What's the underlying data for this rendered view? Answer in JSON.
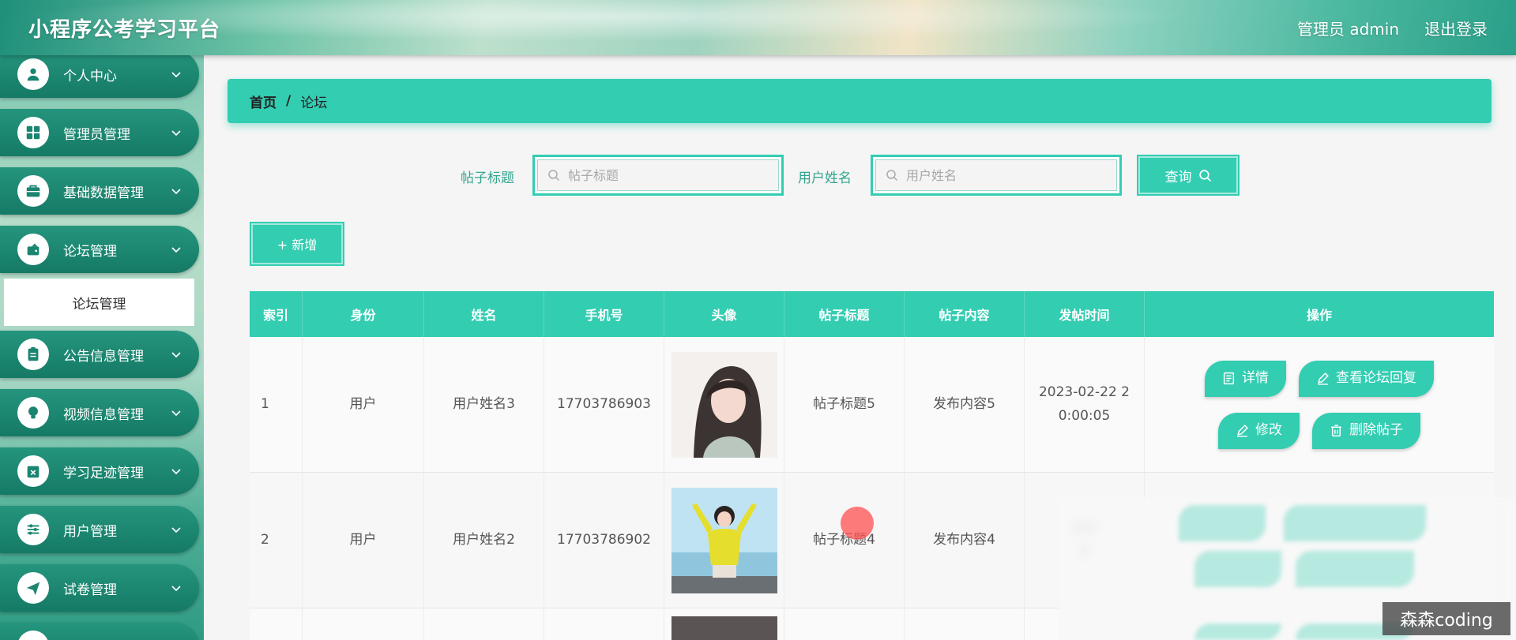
{
  "header": {
    "app_title": "小程序公考学习平台",
    "user_label": "管理员 admin",
    "logout_label": "退出登录"
  },
  "sidebar": {
    "items": [
      {
        "label": "个人中心",
        "icon": "user-icon"
      },
      {
        "label": "管理员管理",
        "icon": "grid-icon"
      },
      {
        "label": "基础数据管理",
        "icon": "briefcase-icon"
      },
      {
        "label": "论坛管理",
        "icon": "wallet-icon"
      },
      {
        "label": "公告信息管理",
        "icon": "clipboard-icon"
      },
      {
        "label": "视频信息管理",
        "icon": "lightbulb-icon"
      },
      {
        "label": "学习足迹管理",
        "icon": "calendar-x-icon"
      },
      {
        "label": "用户管理",
        "icon": "sliders-icon"
      },
      {
        "label": "试卷管理",
        "icon": "send-icon"
      }
    ],
    "submenu": {
      "label": "论坛管理"
    }
  },
  "breadcrumb": {
    "home": "首页",
    "separator": "/",
    "current": "论坛"
  },
  "search": {
    "title_label": "帖子标题",
    "title_placeholder": "帖子标题",
    "user_label": "用户姓名",
    "user_placeholder": "用户姓名",
    "query_label": "查询"
  },
  "toolbar": {
    "add_label": "+ 新增"
  },
  "table": {
    "headers": [
      "索引",
      "身份",
      "姓名",
      "手机号",
      "头像",
      "帖子标题",
      "帖子内容",
      "发帖时间",
      "操作"
    ],
    "rows": [
      {
        "index": "1",
        "role": "用户",
        "name": "用户姓名3",
        "phone": "17703786903",
        "title": "帖子标题5",
        "content": "发布内容5",
        "time_line1": "2023-02-22 2",
        "time_line2": "0:00:05"
      },
      {
        "index": "2",
        "role": "用户",
        "name": "用户姓名2",
        "phone": "17703786902",
        "title": "帖子标题4",
        "content": "发布内容4",
        "time_line1": "202",
        "time_line2": "0"
      }
    ],
    "actions": {
      "detail": "详情",
      "replies": "查看论坛回复",
      "edit": "修改",
      "delete": "删除帖子"
    }
  },
  "watermark": "森森coding",
  "colors": {
    "accent": "#33cdb2",
    "sidebar_item": "#1a8570"
  }
}
